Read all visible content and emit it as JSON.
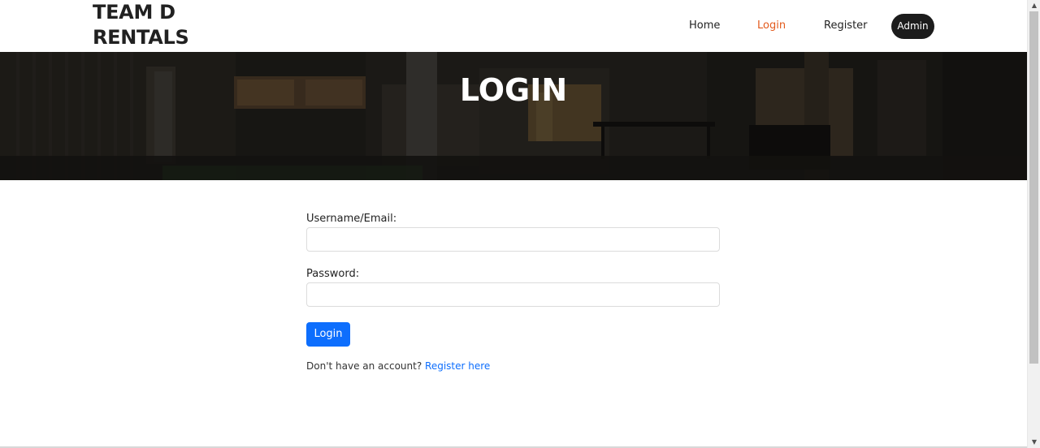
{
  "brand": {
    "line1": "TEAM D",
    "line2": "RENTALS"
  },
  "nav": {
    "home": "Home",
    "login": "Login",
    "register": "Register",
    "admin": "Admin"
  },
  "hero": {
    "title": "LOGIN"
  },
  "form": {
    "username_label": "Username/Email:",
    "username_value": "",
    "password_label": "Password:",
    "password_value": "",
    "submit_label": "Login",
    "signup_prompt": "Don't have an account?",
    "signup_link": "Register here"
  },
  "scrollbar": {
    "up_icon": "▲",
    "down_icon": "▼"
  },
  "colors": {
    "accent_active_nav": "#e35a1c",
    "primary_button": "#0d6efd",
    "link": "#0d6efd",
    "admin_button": "#1c1c1c"
  }
}
